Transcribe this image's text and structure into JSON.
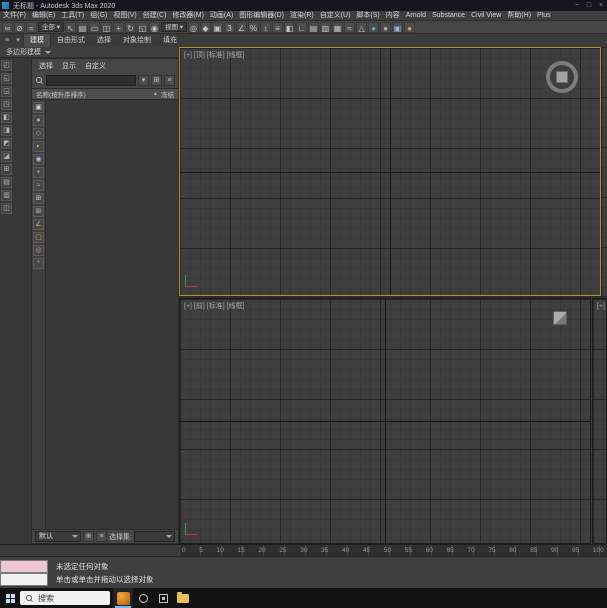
{
  "title_bar": {
    "title": "无标题 - Autodesk 3ds Max 2020",
    "window_buttons": [
      {
        "name": "minimize-button",
        "glyph": "−"
      },
      {
        "name": "maximize-button",
        "glyph": "□"
      },
      {
        "name": "close-button",
        "glyph": "×"
      }
    ]
  },
  "menu_bar": {
    "items": [
      "文件(F)",
      "编辑(E)",
      "工具(T)",
      "组(G)",
      "视图(V)",
      "创建(C)",
      "修改器(M)",
      "动画(A)",
      "图形编辑器(D)",
      "渲染(R)",
      "自定义(U)",
      "脚本(S)",
      "内容",
      "Arnold",
      "Substance",
      "Civil View",
      "帮助(H)",
      "Plus"
    ]
  },
  "main_toolbar": {
    "icons": [
      {
        "name": "select-link-icon",
        "glyph": "∞"
      },
      {
        "name": "unlink-icon",
        "glyph": "⊘"
      },
      {
        "name": "bind-spacewarp-icon",
        "glyph": "≈"
      },
      {
        "name": "selection-filter-dropdown",
        "label": "全部 ▾",
        "cls": "tb-select"
      },
      {
        "name": "select-object-icon",
        "glyph": "↖"
      },
      {
        "name": "select-by-name-icon",
        "glyph": "▤"
      },
      {
        "name": "region-select-icon",
        "glyph": "▭"
      },
      {
        "name": "window-crossing-icon",
        "glyph": "◫"
      },
      {
        "name": "select-move-icon",
        "glyph": "+"
      },
      {
        "name": "select-rotate-icon",
        "glyph": "↻"
      },
      {
        "name": "select-scale-icon",
        "glyph": "◱"
      },
      {
        "name": "select-place-icon",
        "glyph": "◉"
      },
      {
        "name": "ref-coord-dropdown",
        "label": "视图 ▾",
        "cls": "tb-select"
      },
      {
        "name": "pivot-center-icon",
        "glyph": "◎"
      },
      {
        "name": "select-manipulate-icon",
        "glyph": "◆"
      },
      {
        "name": "keyboard-override-icon",
        "glyph": "▣"
      },
      {
        "name": "snap-toggle-icon",
        "glyph": "3"
      },
      {
        "name": "angle-snap-icon",
        "glyph": "∠"
      },
      {
        "name": "percent-snap-icon",
        "glyph": "%"
      },
      {
        "name": "spinner-snap-icon",
        "glyph": "↕"
      },
      {
        "name": "named-selection-sets-icon",
        "glyph": "≡"
      },
      {
        "name": "mirror-icon",
        "glyph": "◧"
      },
      {
        "name": "align-icon",
        "glyph": "∟"
      },
      {
        "name": "toggle-scene-explorer-icon",
        "glyph": "▤"
      },
      {
        "name": "layer-explorer-icon",
        "glyph": "▥"
      },
      {
        "name": "ribbon-toggle-icon",
        "glyph": "▦"
      },
      {
        "name": "curve-editor-icon",
        "glyph": "≈"
      },
      {
        "name": "schematic-view-icon",
        "glyph": "△"
      },
      {
        "name": "material-editor-icon",
        "glyph": "●",
        "color": "#58a6d8"
      },
      {
        "name": "render-setup-icon",
        "glyph": "●",
        "color": "#ababab"
      },
      {
        "name": "rendered-frame-icon",
        "glyph": "▣",
        "color": "#8fb7d9"
      },
      {
        "name": "render-production-icon",
        "glyph": "●",
        "color": "#e0a13e"
      }
    ]
  },
  "ribbon": {
    "controls": [
      {
        "name": "ribbon-menu-icon",
        "glyph": "≡"
      },
      {
        "name": "ribbon-pin-icon",
        "glyph": "▾"
      }
    ],
    "tabs": [
      {
        "label": "建模",
        "cls": "active"
      },
      {
        "label": "自由形式"
      },
      {
        "label": "选择"
      },
      {
        "label": "对象绘制"
      },
      {
        "label": "填充"
      }
    ],
    "collapsed_panel_label": "多边形建模"
  },
  "left_toolbar": {
    "icons": [
      {
        "name": "viewport-layout-tab-icon-1",
        "glyph": "◰"
      },
      {
        "name": "viewport-layout-tab-icon-2",
        "glyph": "◱"
      },
      {
        "name": "viewport-layout-tab-icon-3",
        "glyph": "◲"
      },
      {
        "name": "viewport-layout-tab-icon-4",
        "glyph": "◳"
      },
      {
        "name": "viewport-layout-tab-icon-5",
        "glyph": "◧"
      },
      {
        "name": "viewport-layout-tab-icon-6",
        "glyph": "◨"
      },
      {
        "name": "viewport-layout-tab-icon-7",
        "glyph": "◩"
      },
      {
        "name": "viewport-layout-tab-icon-8",
        "glyph": "◪"
      },
      {
        "name": "viewport-layout-tab-icon-9",
        "glyph": "⊞"
      },
      {
        "name": "viewport-layout-tab-icon-10",
        "glyph": "▤"
      },
      {
        "name": "viewport-layout-tab-icon-11",
        "glyph": "▥"
      },
      {
        "name": "viewport-layout-tab-icon-12",
        "glyph": "◫"
      }
    ]
  },
  "scene_explorer": {
    "menus": [
      "选择",
      "显示",
      "自定义"
    ],
    "search": {
      "value": "",
      "buttons": [
        {
          "name": "search-filter-icon",
          "glyph": "▾"
        },
        {
          "name": "sync-selection-icon",
          "glyph": "⊞"
        },
        {
          "name": "explorer-settings-icon",
          "glyph": "≡"
        }
      ]
    },
    "header": {
      "name_column": "名称(按升序排序)",
      "sort_indicator": "▲",
      "freeze_column": "冻结"
    },
    "filter_icons": [
      {
        "name": "show-all-icon",
        "glyph": "▣",
        "color": "#cfcfcf"
      },
      {
        "name": "show-geometry-icon",
        "glyph": "●",
        "color": "#8fb7d9"
      },
      {
        "name": "show-shapes-icon",
        "glyph": "◇",
        "color": "#8fc9b0"
      },
      {
        "name": "show-lights-icon",
        "glyph": "◐",
        "color": "#d9c76a"
      },
      {
        "name": "show-cameras-icon",
        "glyph": "◉",
        "color": "#a8bfd0"
      },
      {
        "name": "show-helpers-icon",
        "glyph": "+",
        "color": "#8fc9c9"
      },
      {
        "name": "show-spacewarps-icon",
        "glyph": "≈",
        "color": "#9a9ad0"
      },
      {
        "name": "show-groups-icon",
        "glyph": "⊞",
        "color": "#c9c9c9"
      },
      {
        "name": "show-xrefs-icon",
        "glyph": "⊠",
        "color": "#b0b0b0"
      },
      {
        "name": "show-bones-icon",
        "glyph": "∠",
        "color": "#c9b08f"
      },
      {
        "name": "show-containers-icon",
        "glyph": "▢",
        "color": "#c9a86a"
      },
      {
        "name": "show-materials-icon",
        "glyph": "◎",
        "color": "#c98fa0"
      },
      {
        "name": "show-frozen-icon",
        "glyph": "*",
        "color": "#8fb7d9"
      }
    ],
    "footer": {
      "preset_value": "默认",
      "buttons": [
        {
          "name": "add-selection-set-icon",
          "glyph": "⊕"
        },
        {
          "name": "edit-selection-set-icon",
          "glyph": "≡"
        }
      ],
      "selection_set_label": "选择集:"
    }
  },
  "viewports": {
    "top": {
      "label": "[+] [顶] [标准] [线框]"
    },
    "front": {
      "label": "[+] [前] [标准] [线框]"
    },
    "side": {
      "label": "[+] [透视] [标准]"
    }
  },
  "timeline": {
    "tick_labels": [
      "0",
      "5",
      "10",
      "15",
      "20",
      "25",
      "30",
      "35",
      "40",
      "45",
      "50",
      "55",
      "60",
      "65",
      "70",
      "75",
      "80",
      "85",
      "90",
      "95",
      "100"
    ]
  },
  "status_bar": {
    "status_line": "未选定任何对象",
    "prompt_line": "单击或单击并拖动以选择对象"
  },
  "taskbar": {
    "search_label": "搜索",
    "icons": [
      "windows-start-icon",
      "taskbar-search-icon",
      "3ds-max-taskbar-icon",
      "cortana-icon",
      "task-view-icon",
      "file-explorer-icon"
    ]
  }
}
